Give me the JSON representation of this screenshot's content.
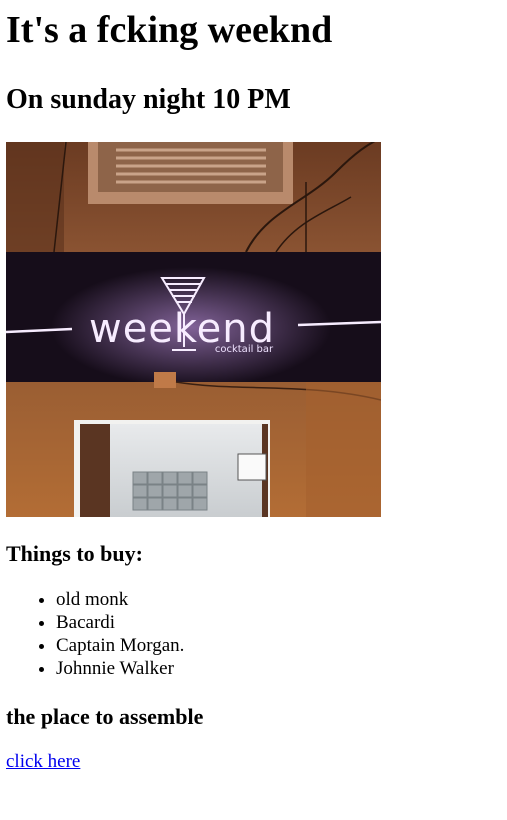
{
  "heading": "It's a fcking weeknd",
  "subheading": "On sunday night 10 PM",
  "photo": {
    "sign_text": "weekend",
    "sign_subtext": "cocktail bar",
    "colors": {
      "wall": "#8a5430",
      "sign_panel": "#140c18",
      "neon": "#f3e6ff",
      "neon_glow": "#c88cf0"
    }
  },
  "shopping": {
    "title": "Things to buy:",
    "items": [
      "old monk",
      "Bacardi",
      "Captain Morgan.",
      "Johnnie Walker"
    ]
  },
  "place": {
    "title": "the place to assemble",
    "link_text": "click here"
  },
  "colors": {
    "link": "#0000ee"
  }
}
